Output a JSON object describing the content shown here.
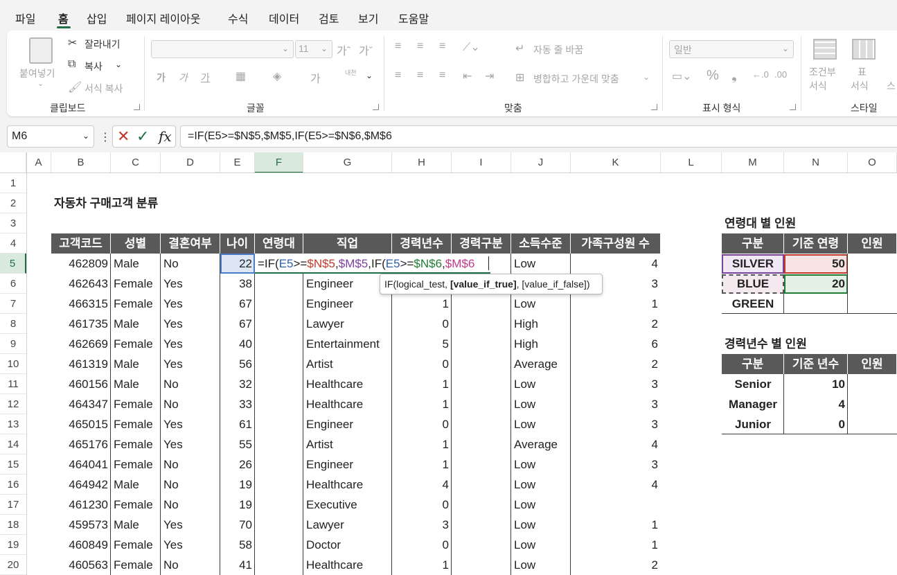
{
  "menu": [
    "파일",
    "홈",
    "삽입",
    "페이지 레이아웃",
    "수식",
    "데이터",
    "검토",
    "보기",
    "도움말"
  ],
  "ribbon": {
    "clipboard": {
      "paste": "붙여넣기",
      "cut": "잘라내기",
      "copy": "복사",
      "format_painter": "서식 복사",
      "label": "클립보드"
    },
    "font": {
      "size": "11",
      "bold": "가",
      "italic": "가",
      "underline": "가",
      "label": "글꼴",
      "wrap_label": "내천"
    },
    "align": {
      "wrap": "자동 줄 바꿈",
      "merge": "병합하고 가운데 맞춤",
      "label": "맞춤"
    },
    "number": {
      "format": "일반",
      "label": "표시 형식"
    },
    "styles": {
      "conditional": "조건부",
      "conditional2": "서식",
      "table": "표",
      "table2": "서식",
      "label": "스타일",
      "cell_style": "스"
    }
  },
  "namebox": "M6",
  "formula": "=IF(E5>=$N$5,$M$5,IF(E5>=$N$6,$M$6",
  "columns": [
    "A",
    "B",
    "C",
    "D",
    "E",
    "F",
    "G",
    "H",
    "I",
    "J",
    "K",
    "L",
    "M",
    "N",
    "O"
  ],
  "rows": [
    "1",
    "2",
    "3",
    "4",
    "5",
    "6",
    "7",
    "8",
    "9",
    "10",
    "11",
    "12",
    "13",
    "14",
    "15",
    "16",
    "17",
    "18",
    "19",
    "20"
  ],
  "sheet": {
    "title": "자동차 구매고객 분류",
    "headers": [
      "고객코드",
      "성별",
      "결혼여부",
      "나이",
      "연령대",
      "직업",
      "경력년수",
      "경력구분",
      "소득수준",
      "가족구성원 수"
    ],
    "data": [
      [
        "462809",
        "Male",
        "No",
        "22",
        "",
        "",
        "",
        "",
        "Low",
        "4"
      ],
      [
        "462643",
        "Female",
        "Yes",
        "38",
        "",
        "Engineer",
        "",
        "",
        "",
        "3"
      ],
      [
        "466315",
        "Female",
        "Yes",
        "67",
        "",
        "Engineer",
        "1",
        "",
        "Low",
        "1"
      ],
      [
        "461735",
        "Male",
        "Yes",
        "67",
        "",
        "Lawyer",
        "0",
        "",
        "High",
        "2"
      ],
      [
        "462669",
        "Female",
        "Yes",
        "40",
        "",
        "Entertainment",
        "5",
        "",
        "High",
        "6"
      ],
      [
        "461319",
        "Male",
        "Yes",
        "56",
        "",
        "Artist",
        "0",
        "",
        "Average",
        "2"
      ],
      [
        "460156",
        "Male",
        "No",
        "32",
        "",
        "Healthcare",
        "1",
        "",
        "Low",
        "3"
      ],
      [
        "464347",
        "Female",
        "No",
        "33",
        "",
        "Healthcare",
        "1",
        "",
        "Low",
        "3"
      ],
      [
        "465015",
        "Female",
        "Yes",
        "61",
        "",
        "Engineer",
        "0",
        "",
        "Low",
        "3"
      ],
      [
        "465176",
        "Female",
        "Yes",
        "55",
        "",
        "Artist",
        "1",
        "",
        "Average",
        "4"
      ],
      [
        "464041",
        "Female",
        "No",
        "26",
        "",
        "Engineer",
        "1",
        "",
        "Low",
        "3"
      ],
      [
        "464942",
        "Male",
        "No",
        "19",
        "",
        "Healthcare",
        "4",
        "",
        "Low",
        "4"
      ],
      [
        "461230",
        "Female",
        "No",
        "19",
        "",
        "Executive",
        "0",
        "",
        "Low",
        ""
      ],
      [
        "459573",
        "Male",
        "Yes",
        "70",
        "",
        "Lawyer",
        "3",
        "",
        "Low",
        "1"
      ],
      [
        "460849",
        "Female",
        "Yes",
        "58",
        "",
        "Doctor",
        "0",
        "",
        "Low",
        "1"
      ],
      [
        "460563",
        "Female",
        "No",
        "41",
        "",
        "Healthcare",
        "1",
        "",
        "Low",
        "2"
      ]
    ],
    "edit_parts": [
      "=IF(",
      "E5",
      ">=",
      "$N$5",
      ",",
      "$M$5",
      ",IF(",
      "E5",
      ">=",
      "$N$6",
      ",",
      "$M$6"
    ],
    "tooltip_parts": [
      "IF(logical_test, ",
      "[value_if_true]",
      ", [value_if_false])"
    ]
  },
  "age_table": {
    "title": "연령대 별 인원",
    "headers": [
      "구분",
      "기준 연령",
      "인원"
    ],
    "rows": [
      [
        "SILVER",
        "50",
        ""
      ],
      [
        "BLUE",
        "20",
        ""
      ],
      [
        "GREEN",
        "",
        ""
      ]
    ]
  },
  "career_table": {
    "title": "경력년수 별 인원",
    "headers": [
      "구분",
      "기준 년수",
      "인원"
    ],
    "rows": [
      [
        "Senior",
        "10",
        ""
      ],
      [
        "Manager",
        "4",
        ""
      ],
      [
        "Junior",
        "0",
        ""
      ]
    ]
  },
  "colors": {
    "excel_green": "#1f6e43",
    "header_gray": "#595959",
    "ref_blue": "#2e5fa8",
    "ref_red": "#c0392b",
    "ref_purple": "#7b3fa0",
    "ref_green": "#1e7b34"
  }
}
